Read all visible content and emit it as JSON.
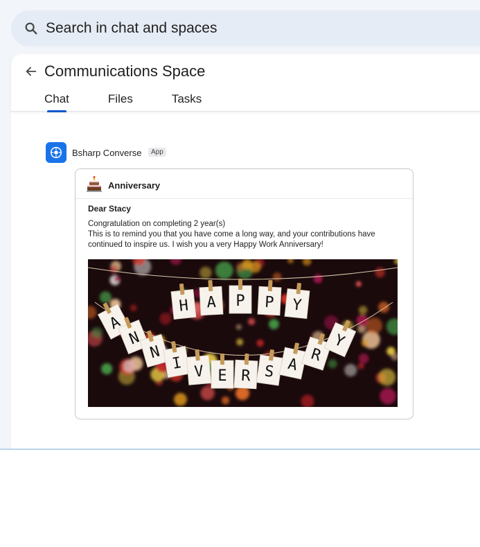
{
  "search": {
    "placeholder": "Search in chat and spaces"
  },
  "space": {
    "title": "Communications Space",
    "tabs": [
      {
        "label": "Chat",
        "active": true
      },
      {
        "label": "Files",
        "active": false
      },
      {
        "label": "Tasks",
        "active": false
      }
    ]
  },
  "message": {
    "sender": "Bsharp Converse",
    "badge": "App",
    "card": {
      "title": "Anniversary",
      "greeting": "Dear Stacy",
      "lines": [
        "Congratulation on completing 2 year(s)",
        "This is to remind you that you have come a long way, and your contributions have",
        "continued to inspire us. I wish you a very Happy Work Anniversary!"
      ],
      "banner": {
        "word_top": [
          "H",
          "A",
          "P",
          "P",
          "Y"
        ],
        "word_bottom": [
          "A",
          "N",
          "N",
          "I",
          "V",
          "E",
          "R",
          "S",
          "A",
          "R",
          "Y"
        ]
      }
    }
  },
  "colors": {
    "accent": "#0b57d0",
    "app_icon": "#1a73e8"
  }
}
